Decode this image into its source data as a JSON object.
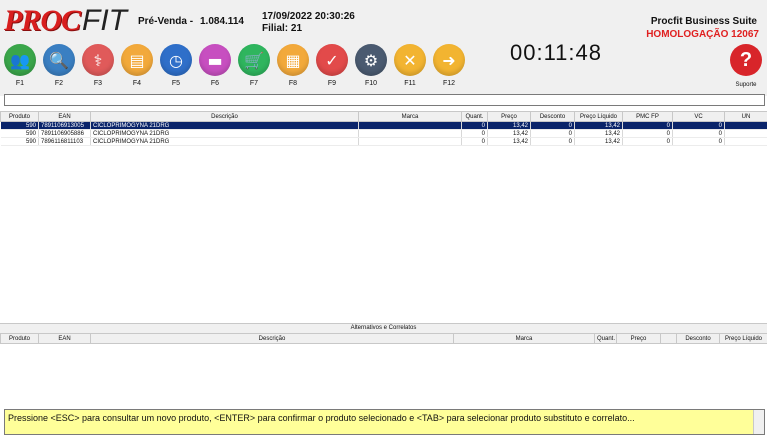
{
  "header": {
    "logo_proc": "PROC",
    "logo_fit": "FIT",
    "mode": "Pré-Venda -",
    "pv_number": "1.084.114",
    "datetime": "17/09/2022 20:30:26",
    "filial": "Filial: 21",
    "suite": "Procfit Business Suite",
    "homolog": "HOMOLOGAÇÃO 12067",
    "clock": "00:11:48"
  },
  "fkeys": [
    {
      "label": "F1",
      "icon": "users-icon",
      "color": "#3aa64a"
    },
    {
      "label": "F2",
      "icon": "search-icon",
      "color": "#3a7fc2"
    },
    {
      "label": "F3",
      "icon": "caduceus-icon",
      "color": "#e05a5a"
    },
    {
      "label": "F4",
      "icon": "id-card-icon",
      "color": "#f2a93b"
    },
    {
      "label": "F5",
      "icon": "clock-icon",
      "color": "#2f6fc9"
    },
    {
      "label": "F6",
      "icon": "truck-icon",
      "color": "#c74fc0"
    },
    {
      "label": "F7",
      "icon": "cart-icon",
      "color": "#2fb55e"
    },
    {
      "label": "F8",
      "icon": "cards-icon",
      "color": "#f2a93b"
    },
    {
      "label": "F9",
      "icon": "check-icon",
      "color": "#e24a4a"
    },
    {
      "label": "F10",
      "icon": "gears-icon",
      "color": "#4a5a70"
    },
    {
      "label": "F11",
      "icon": "cancel-icon",
      "color": "#f2b431"
    },
    {
      "label": "F12",
      "icon": "arrow-right-icon",
      "color": "#f2b431"
    }
  ],
  "support": {
    "label": "Suporte",
    "icon": "help-icon"
  },
  "products": {
    "columns": [
      "Produto",
      "EAN",
      "Descrição",
      "Marca",
      "Quant.",
      "Preço",
      "Desconto",
      "Preço Líquido",
      "PMC FP",
      "VC",
      "UN"
    ],
    "rows": [
      {
        "produto": "590",
        "ean": "7891106913005",
        "descricao": "CICLOPRIMOGYNA 21DRG",
        "marca": "",
        "quant": "0",
        "preco": "13,42",
        "desconto": "0",
        "preco_liquido": "13,42",
        "pmc_fp": "0",
        "vc": "0",
        "un": ""
      },
      {
        "produto": "590",
        "ean": "7891106905886",
        "descricao": "CICLOPRIMOGYNA 21DRG",
        "marca": "",
        "quant": "0",
        "preco": "13,42",
        "desconto": "0",
        "preco_liquido": "13,42",
        "pmc_fp": "0",
        "vc": "0",
        "un": ""
      },
      {
        "produto": "590",
        "ean": "7896116811103",
        "descricao": "CICLOPRIMOGYNA 21DRG",
        "marca": "",
        "quant": "0",
        "preco": "13,42",
        "desconto": "0",
        "preco_liquido": "13,42",
        "pmc_fp": "0",
        "vc": "0",
        "un": ""
      }
    ]
  },
  "alternatives": {
    "title": "Alternativos e Correlatos",
    "columns": [
      "Produto",
      "EAN",
      "Descrição",
      "Marca",
      "Quant.",
      "Preço",
      "",
      "Desconto",
      "Preço Líquido"
    ]
  },
  "status_text": "Pressione <ESC> para consultar um novo produto, <ENTER> para confirmar o produto selecionado e <TAB> para selecionar produto substituto e correlato..."
}
